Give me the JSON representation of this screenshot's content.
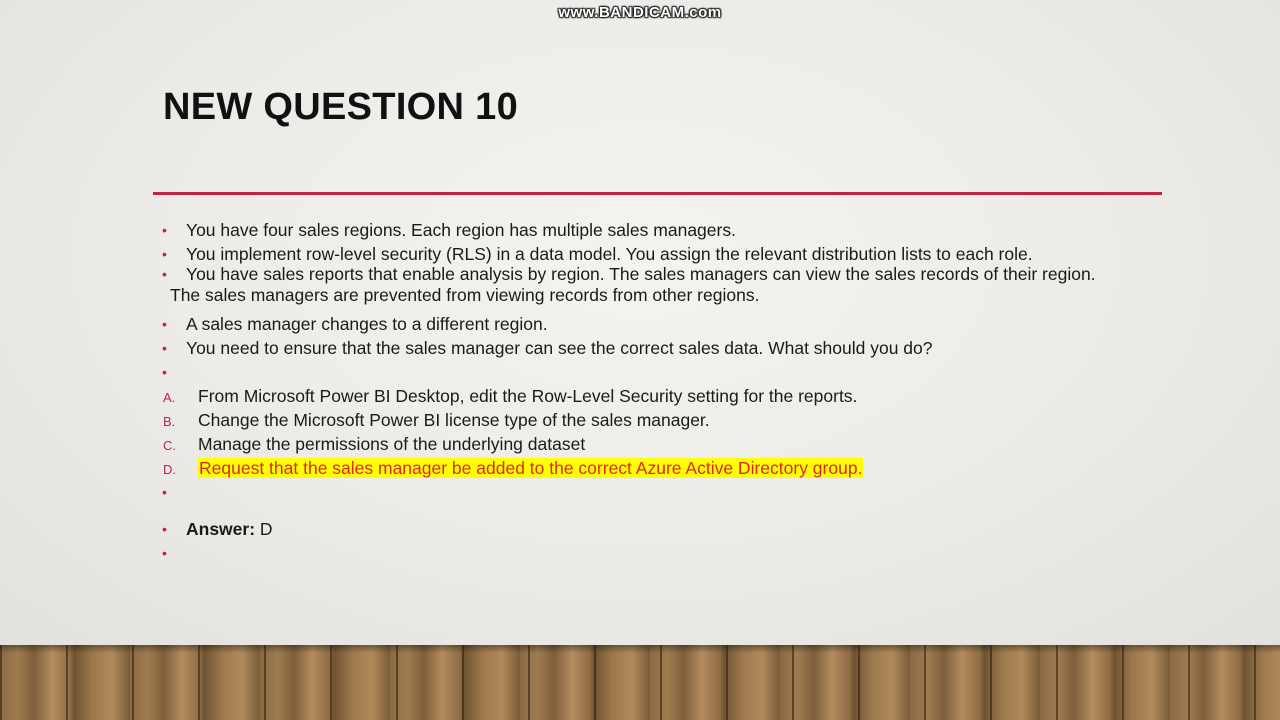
{
  "watermark": "www.BANDICAM.com",
  "title": "NEW QUESTION 10",
  "bullets": [
    "You have four sales regions. Each region has multiple sales managers.",
    "You implement row-level security (RLS) in a data model. You assign the relevant distribution lists to each role.",
    "You have sales reports that enable analysis by region. The sales managers can view the sales records of their region.",
    "A sales manager changes to a different region.",
    "You need to ensure that the sales manager can see the correct sales data. What should you do?"
  ],
  "continuation": "The sales managers are prevented from viewing records from other regions.",
  "options": [
    {
      "letter": "A.",
      "text": "From Microsoft Power BI Desktop, edit the Row-Level Security setting for the reports."
    },
    {
      "letter": "B.",
      "text": "Change the Microsoft Power BI license type of the sales manager."
    },
    {
      "letter": "C.",
      "text": "Manage the permissions of the underlying dataset"
    },
    {
      "letter": "D.",
      "text": "Request that the sales manager be added to the correct Azure Active Directory group."
    }
  ],
  "answer": {
    "label": "Answer:",
    "value": " D"
  },
  "colors": {
    "accent": "#c0243f",
    "highlight": "#ffff00",
    "highlight_text": "#e0262a"
  }
}
